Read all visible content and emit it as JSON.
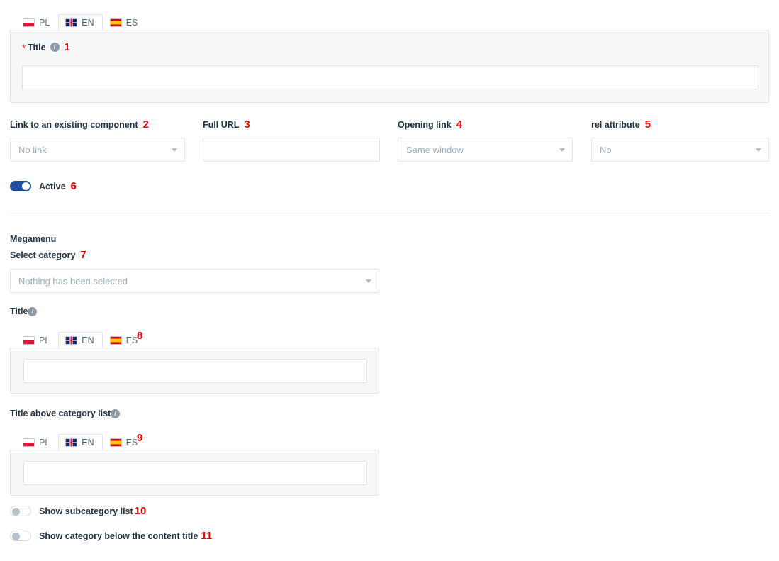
{
  "languages": [
    {
      "code": "PL",
      "flag": "flag-pl-icon",
      "active": false
    },
    {
      "code": "EN",
      "flag": "flag-en-icon",
      "active": true
    },
    {
      "code": "ES",
      "flag": "flag-es-icon",
      "active": false
    }
  ],
  "annotations": {
    "a1": "1",
    "a2": "2",
    "a3": "3",
    "a4": "4",
    "a5": "5",
    "a6": "6",
    "a7": "7",
    "a8": "8",
    "a9": "9",
    "a10": "10",
    "a11": "11",
    "color": "#ef0000"
  },
  "main_title": {
    "label": "Title",
    "required_marker": "*",
    "info_icon": "info-icon",
    "value": "",
    "placeholder": ""
  },
  "fields": {
    "link_component": {
      "label": "Link to an existing component",
      "selected": "No link"
    },
    "full_url": {
      "label": "Full URL",
      "value": "",
      "placeholder": ""
    },
    "opening_link": {
      "label": "Opening link",
      "selected": "Same window"
    },
    "rel_attribute": {
      "label": "rel attribute",
      "selected": "No"
    }
  },
  "active_toggle": {
    "label": "Active",
    "state": "on"
  },
  "megamenu": {
    "heading": "Megamenu",
    "select_category": {
      "label": "Select category",
      "selected": "Nothing has been selected"
    },
    "title": {
      "label": "Title",
      "info_icon": "info-icon",
      "value": "",
      "placeholder": ""
    },
    "title_above_category_list": {
      "label": "Title above category list",
      "info_icon": "info-icon",
      "value": "",
      "placeholder": ""
    },
    "show_subcategory_list": {
      "label": "Show subcategory list",
      "state": "off"
    },
    "show_category_below_content_title": {
      "label": "Show category below the content title",
      "state": "off"
    }
  },
  "icons": {
    "caret": "chevron-down-icon",
    "info": "info-icon"
  }
}
